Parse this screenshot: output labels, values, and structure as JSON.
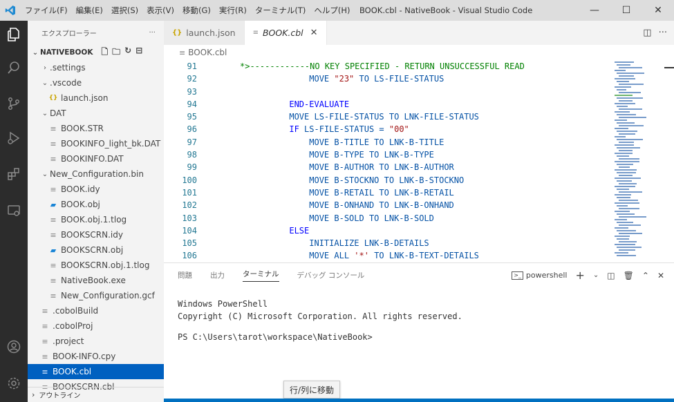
{
  "titlebar": {
    "menu": [
      "ファイル(F)",
      "編集(E)",
      "選択(S)",
      "表示(V)",
      "移動(G)",
      "実行(R)",
      "ターミナル(T)",
      "ヘルプ(H)"
    ],
    "title": "BOOK.cbl - NativeBook - Visual Studio Code",
    "minimize": "—",
    "maximize": "☐",
    "close": "✕"
  },
  "sidebar": {
    "header": "エクスプローラー",
    "more": "···",
    "workspace": "NATIVEBOOK",
    "items": [
      {
        "label": ".settings",
        "chev": "›",
        "indent": 1,
        "icon": ""
      },
      {
        "label": ".vscode",
        "chev": "⌄",
        "indent": 1,
        "icon": ""
      },
      {
        "label": "launch.json",
        "chev": "",
        "indent": 2,
        "icon": "{}"
      },
      {
        "label": "DAT",
        "chev": "⌄",
        "indent": 1,
        "icon": ""
      },
      {
        "label": "BOOK.STR",
        "chev": "",
        "indent": 2,
        "icon": "≡"
      },
      {
        "label": "BOOKINFO_light_bk.DAT",
        "chev": "",
        "indent": 2,
        "icon": "≡"
      },
      {
        "label": "BOOKINFO.DAT",
        "chev": "",
        "indent": 2,
        "icon": "≡"
      },
      {
        "label": "New_Configuration.bin",
        "chev": "⌄",
        "indent": 1,
        "icon": ""
      },
      {
        "label": "BOOK.idy",
        "chev": "",
        "indent": 2,
        "icon": "≡"
      },
      {
        "label": "BOOK.obj",
        "chev": "",
        "indent": 2,
        "icon": "▰"
      },
      {
        "label": "BOOK.obj.1.tlog",
        "chev": "",
        "indent": 2,
        "icon": "≡"
      },
      {
        "label": "BOOKSCRN.idy",
        "chev": "",
        "indent": 2,
        "icon": "≡"
      },
      {
        "label": "BOOKSCRN.obj",
        "chev": "",
        "indent": 2,
        "icon": "▰"
      },
      {
        "label": "BOOKSCRN.obj.1.tlog",
        "chev": "",
        "indent": 2,
        "icon": "≡"
      },
      {
        "label": "NativeBook.exe",
        "chev": "",
        "indent": 2,
        "icon": "≡"
      },
      {
        "label": "New_Configuration.gcf",
        "chev": "",
        "indent": 2,
        "icon": "≡"
      },
      {
        "label": ".cobolBuild",
        "chev": "",
        "indent": 1,
        "icon": "≡"
      },
      {
        "label": ".cobolProj",
        "chev": "",
        "indent": 1,
        "icon": "≡"
      },
      {
        "label": ".project",
        "chev": "",
        "indent": 1,
        "icon": "≡"
      },
      {
        "label": "BOOK-INFO.cpy",
        "chev": "",
        "indent": 1,
        "icon": "≡"
      },
      {
        "label": "BOOK.cbl",
        "chev": "",
        "indent": 1,
        "icon": "≡",
        "selected": true
      },
      {
        "label": "BOOKSCRN.cbl",
        "chev": "",
        "indent": 1,
        "icon": "≡"
      }
    ],
    "outline": "アウトライン"
  },
  "tabs": [
    {
      "label": "launch.json",
      "icon": "{}",
      "active": false
    },
    {
      "label": "BOOK.cbl",
      "icon": "≡",
      "active": true,
      "close": "✕"
    }
  ],
  "breadcrumb": "BOOK.cbl",
  "code": [
    {
      "n": "91",
      "parts": [
        [
          "star",
          "*>"
        ],
        [
          "cmt",
          "------------NO KEY SPECIFIED - RETURN UNSUCCESSFUL READ"
        ]
      ],
      "indent": 0,
      "comment": true
    },
    {
      "n": "92",
      "parts": [
        [
          "txt",
          "MOVE "
        ],
        [
          "str",
          "\"23\""
        ],
        [
          "txt",
          " TO LS-FILE-STATUS"
        ]
      ],
      "indent": 10
    },
    {
      "n": "93",
      "parts": [],
      "indent": 0
    },
    {
      "n": "94",
      "parts": [
        [
          "kw",
          "END-EVALUATE"
        ]
      ],
      "indent": 6
    },
    {
      "n": "95",
      "parts": [
        [
          "txt",
          "MOVE LS-FILE-STATUS TO LNK-FILE-STATUS"
        ]
      ],
      "indent": 6
    },
    {
      "n": "96",
      "parts": [
        [
          "kw",
          "IF "
        ],
        [
          "txt",
          "LS-FILE-STATUS = "
        ],
        [
          "str",
          "\"00\""
        ]
      ],
      "indent": 6
    },
    {
      "n": "97",
      "parts": [
        [
          "txt",
          "MOVE B-TITLE TO LNK-B-TITLE"
        ]
      ],
      "indent": 10
    },
    {
      "n": "98",
      "parts": [
        [
          "txt",
          "MOVE B-TYPE TO LNK-B-TYPE"
        ]
      ],
      "indent": 10
    },
    {
      "n": "99",
      "parts": [
        [
          "txt",
          "MOVE B-AUTHOR TO LNK-B-AUTHOR"
        ]
      ],
      "indent": 10
    },
    {
      "n": "100",
      "parts": [
        [
          "txt",
          "MOVE B-STOCKNO TO LNK-B-STOCKNO"
        ]
      ],
      "indent": 10
    },
    {
      "n": "101",
      "parts": [
        [
          "txt",
          "MOVE B-RETAIL TO LNK-B-RETAIL"
        ]
      ],
      "indent": 10
    },
    {
      "n": "102",
      "parts": [
        [
          "txt",
          "MOVE B-ONHAND TO LNK-B-ONHAND"
        ]
      ],
      "indent": 10
    },
    {
      "n": "103",
      "parts": [
        [
          "txt",
          "MOVE B-SOLD TO LNK-B-SOLD"
        ]
      ],
      "indent": 10
    },
    {
      "n": "104",
      "parts": [
        [
          "kw",
          "ELSE"
        ]
      ],
      "indent": 6
    },
    {
      "n": "105",
      "parts": [
        [
          "txt",
          "INITIALIZE LNK-B-DETAILS"
        ]
      ],
      "indent": 10
    },
    {
      "n": "106",
      "parts": [
        [
          "txt",
          "MOVE ALL "
        ],
        [
          "str",
          "'*'"
        ],
        [
          "txt",
          " TO LNK-B-TEXT-DETAILS"
        ]
      ],
      "indent": 10
    }
  ],
  "panel": {
    "tabs": [
      "問題",
      "出力",
      "ターミナル",
      "デバッグ コンソール"
    ],
    "active_tab": 2,
    "shell": "powershell",
    "terminal": [
      "Windows PowerShell",
      "Copyright (C) Microsoft Corporation. All rights reserved.",
      "",
      "PS C:\\Users\\tarot\\workspace\\NativeBook>"
    ]
  },
  "tooltip": "行/列に移動",
  "colors": {
    "activity_bg": "#2c2c2c",
    "selection": "#0060c0",
    "vscode_blue": "#0078d4"
  }
}
